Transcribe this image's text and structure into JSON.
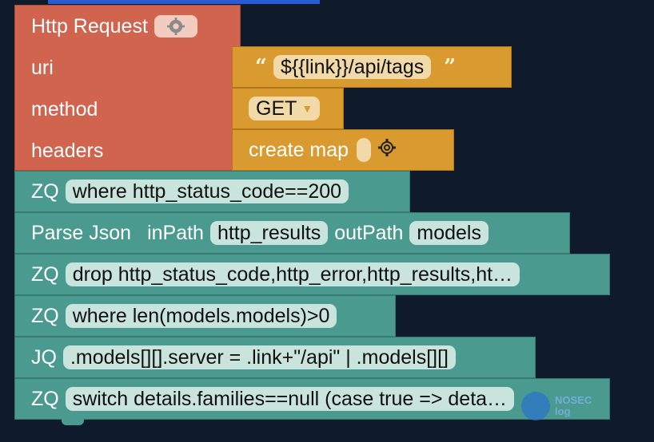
{
  "http": {
    "title": "Http Request",
    "uri_label": "uri",
    "method_label": "method",
    "headers_label": "headers"
  },
  "uri": {
    "value": "${{link}}/api/tags"
  },
  "method": {
    "value": "GET"
  },
  "headers": {
    "label": "create map"
  },
  "blocks": [
    {
      "label": "ZQ",
      "field": "where http_status_code==200"
    },
    {
      "label": "Parse Json",
      "inpath_label": "inPath",
      "inpath": "http_results",
      "outpath_label": "outPath",
      "outpath": "models"
    },
    {
      "label": "ZQ",
      "field": "drop http_status_code,http_error,http_results,ht…"
    },
    {
      "label": "ZQ",
      "field": "where len(models.models)>0"
    },
    {
      "label": "JQ",
      "field": ".models[][].server = .link+\"/api\" | .models[][]"
    },
    {
      "label": "ZQ",
      "field": "switch details.families==null (case true => deta…"
    }
  ],
  "watermark": {
    "line1": "NOSEC",
    "line2": "log"
  },
  "colors": {
    "http": "#d0644e",
    "value": "#d99a2f",
    "teal": "#4a9a90",
    "background": "#0f1a2a"
  }
}
